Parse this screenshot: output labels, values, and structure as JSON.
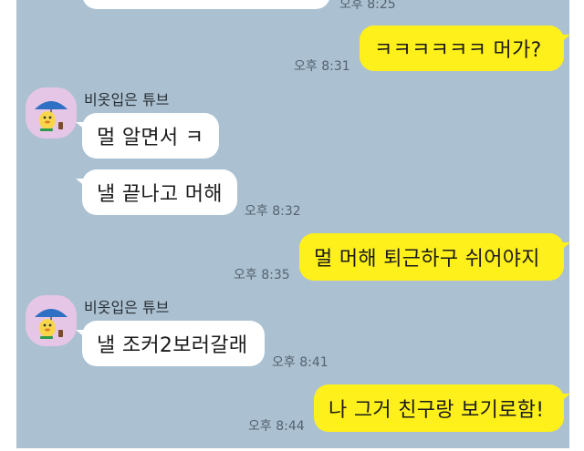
{
  "messages": {
    "m0": {
      "text": "",
      "time": "오후 8:25"
    },
    "m1": {
      "text": "ㅋㅋㅋㅋㅋㅋ 머가?",
      "time": "오후 8:31"
    },
    "sender1": "비옷입은 튜브",
    "m2": {
      "text": "멀 알면서 ㅋ"
    },
    "m3": {
      "text": "낼 끝나고 머해",
      "time": "오후 8:32"
    },
    "m4": {
      "text": "멀 머해 퇴근하구 쉬어야지",
      "time": "오후 8:35"
    },
    "sender2": "비옷입은 튜브",
    "m5": {
      "text": "낼 조커2보러갈래",
      "time": "오후 8:41"
    },
    "m6": {
      "text": "나 그거 친구랑 보기로함!",
      "time": "오후 8:44"
    }
  },
  "colors": {
    "background": "#abc1d1",
    "outgoing_bubble": "#fef01b",
    "incoming_bubble": "#ffffff",
    "avatar_bg": "#e6c6e6"
  },
  "icons": {
    "avatar": "tube-raincoat-avatar"
  }
}
